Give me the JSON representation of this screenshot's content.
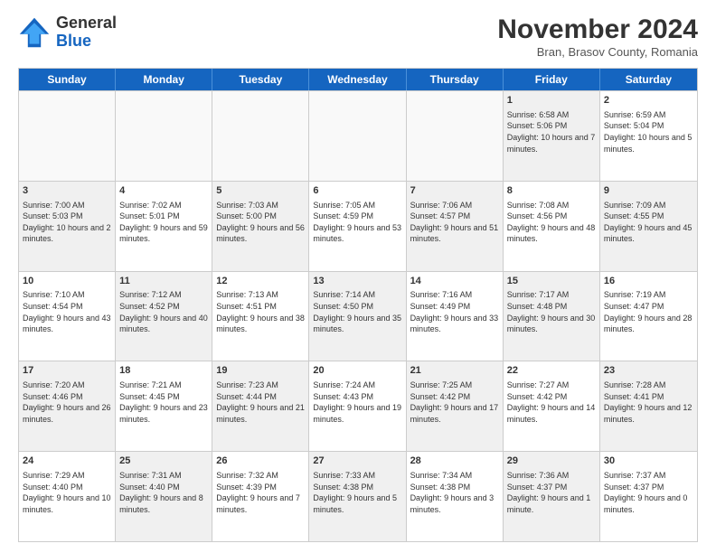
{
  "logo": {
    "general": "General",
    "blue": "Blue"
  },
  "header": {
    "month": "November 2024",
    "location": "Bran, Brasov County, Romania"
  },
  "weekdays": [
    "Sunday",
    "Monday",
    "Tuesday",
    "Wednesday",
    "Thursday",
    "Friday",
    "Saturday"
  ],
  "rows": [
    [
      {
        "day": "",
        "info": "",
        "shaded": false,
        "empty": true
      },
      {
        "day": "",
        "info": "",
        "shaded": false,
        "empty": true
      },
      {
        "day": "",
        "info": "",
        "shaded": false,
        "empty": true
      },
      {
        "day": "",
        "info": "",
        "shaded": false,
        "empty": true
      },
      {
        "day": "",
        "info": "",
        "shaded": false,
        "empty": true
      },
      {
        "day": "1",
        "info": "Sunrise: 6:58 AM\nSunset: 5:06 PM\nDaylight: 10 hours and 7 minutes.",
        "shaded": true,
        "empty": false
      },
      {
        "day": "2",
        "info": "Sunrise: 6:59 AM\nSunset: 5:04 PM\nDaylight: 10 hours and 5 minutes.",
        "shaded": false,
        "empty": false
      }
    ],
    [
      {
        "day": "3",
        "info": "Sunrise: 7:00 AM\nSunset: 5:03 PM\nDaylight: 10 hours and 2 minutes.",
        "shaded": true,
        "empty": false
      },
      {
        "day": "4",
        "info": "Sunrise: 7:02 AM\nSunset: 5:01 PM\nDaylight: 9 hours and 59 minutes.",
        "shaded": false,
        "empty": false
      },
      {
        "day": "5",
        "info": "Sunrise: 7:03 AM\nSunset: 5:00 PM\nDaylight: 9 hours and 56 minutes.",
        "shaded": true,
        "empty": false
      },
      {
        "day": "6",
        "info": "Sunrise: 7:05 AM\nSunset: 4:59 PM\nDaylight: 9 hours and 53 minutes.",
        "shaded": false,
        "empty": false
      },
      {
        "day": "7",
        "info": "Sunrise: 7:06 AM\nSunset: 4:57 PM\nDaylight: 9 hours and 51 minutes.",
        "shaded": true,
        "empty": false
      },
      {
        "day": "8",
        "info": "Sunrise: 7:08 AM\nSunset: 4:56 PM\nDaylight: 9 hours and 48 minutes.",
        "shaded": false,
        "empty": false
      },
      {
        "day": "9",
        "info": "Sunrise: 7:09 AM\nSunset: 4:55 PM\nDaylight: 9 hours and 45 minutes.",
        "shaded": true,
        "empty": false
      }
    ],
    [
      {
        "day": "10",
        "info": "Sunrise: 7:10 AM\nSunset: 4:54 PM\nDaylight: 9 hours and 43 minutes.",
        "shaded": false,
        "empty": false
      },
      {
        "day": "11",
        "info": "Sunrise: 7:12 AM\nSunset: 4:52 PM\nDaylight: 9 hours and 40 minutes.",
        "shaded": true,
        "empty": false
      },
      {
        "day": "12",
        "info": "Sunrise: 7:13 AM\nSunset: 4:51 PM\nDaylight: 9 hours and 38 minutes.",
        "shaded": false,
        "empty": false
      },
      {
        "day": "13",
        "info": "Sunrise: 7:14 AM\nSunset: 4:50 PM\nDaylight: 9 hours and 35 minutes.",
        "shaded": true,
        "empty": false
      },
      {
        "day": "14",
        "info": "Sunrise: 7:16 AM\nSunset: 4:49 PM\nDaylight: 9 hours and 33 minutes.",
        "shaded": false,
        "empty": false
      },
      {
        "day": "15",
        "info": "Sunrise: 7:17 AM\nSunset: 4:48 PM\nDaylight: 9 hours and 30 minutes.",
        "shaded": true,
        "empty": false
      },
      {
        "day": "16",
        "info": "Sunrise: 7:19 AM\nSunset: 4:47 PM\nDaylight: 9 hours and 28 minutes.",
        "shaded": false,
        "empty": false
      }
    ],
    [
      {
        "day": "17",
        "info": "Sunrise: 7:20 AM\nSunset: 4:46 PM\nDaylight: 9 hours and 26 minutes.",
        "shaded": true,
        "empty": false
      },
      {
        "day": "18",
        "info": "Sunrise: 7:21 AM\nSunset: 4:45 PM\nDaylight: 9 hours and 23 minutes.",
        "shaded": false,
        "empty": false
      },
      {
        "day": "19",
        "info": "Sunrise: 7:23 AM\nSunset: 4:44 PM\nDaylight: 9 hours and 21 minutes.",
        "shaded": true,
        "empty": false
      },
      {
        "day": "20",
        "info": "Sunrise: 7:24 AM\nSunset: 4:43 PM\nDaylight: 9 hours and 19 minutes.",
        "shaded": false,
        "empty": false
      },
      {
        "day": "21",
        "info": "Sunrise: 7:25 AM\nSunset: 4:42 PM\nDaylight: 9 hours and 17 minutes.",
        "shaded": true,
        "empty": false
      },
      {
        "day": "22",
        "info": "Sunrise: 7:27 AM\nSunset: 4:42 PM\nDaylight: 9 hours and 14 minutes.",
        "shaded": false,
        "empty": false
      },
      {
        "day": "23",
        "info": "Sunrise: 7:28 AM\nSunset: 4:41 PM\nDaylight: 9 hours and 12 minutes.",
        "shaded": true,
        "empty": false
      }
    ],
    [
      {
        "day": "24",
        "info": "Sunrise: 7:29 AM\nSunset: 4:40 PM\nDaylight: 9 hours and 10 minutes.",
        "shaded": false,
        "empty": false
      },
      {
        "day": "25",
        "info": "Sunrise: 7:31 AM\nSunset: 4:40 PM\nDaylight: 9 hours and 8 minutes.",
        "shaded": true,
        "empty": false
      },
      {
        "day": "26",
        "info": "Sunrise: 7:32 AM\nSunset: 4:39 PM\nDaylight: 9 hours and 7 minutes.",
        "shaded": false,
        "empty": false
      },
      {
        "day": "27",
        "info": "Sunrise: 7:33 AM\nSunset: 4:38 PM\nDaylight: 9 hours and 5 minutes.",
        "shaded": true,
        "empty": false
      },
      {
        "day": "28",
        "info": "Sunrise: 7:34 AM\nSunset: 4:38 PM\nDaylight: 9 hours and 3 minutes.",
        "shaded": false,
        "empty": false
      },
      {
        "day": "29",
        "info": "Sunrise: 7:36 AM\nSunset: 4:37 PM\nDaylight: 9 hours and 1 minute.",
        "shaded": true,
        "empty": false
      },
      {
        "day": "30",
        "info": "Sunrise: 7:37 AM\nSunset: 4:37 PM\nDaylight: 9 hours and 0 minutes.",
        "shaded": false,
        "empty": false
      }
    ]
  ]
}
